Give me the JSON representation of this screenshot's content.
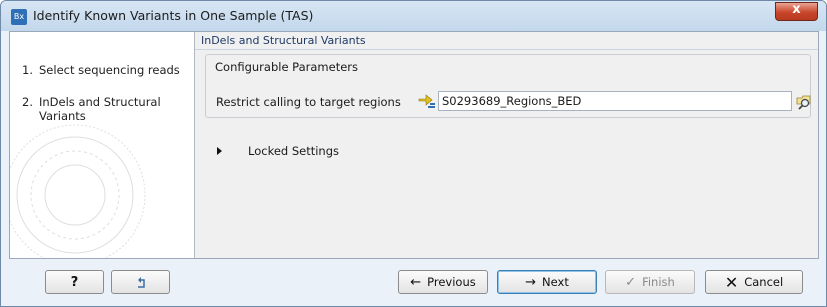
{
  "window": {
    "title": "Identify Known Variants in One Sample (TAS)",
    "app_icon_text": "Bx",
    "close_glyph": "x"
  },
  "steps": [
    {
      "number": "1.",
      "label": "Select sequencing reads"
    },
    {
      "number": "2.",
      "label": "InDels and Structural Variants"
    }
  ],
  "panel": {
    "header": "InDels and Structural Variants",
    "group_title": "Configurable Parameters",
    "restrict_label": "Restrict calling to target regions",
    "restrict_value": "S0293689_Regions_BED",
    "locked_label": "Locked Settings"
  },
  "buttons": {
    "help": "?",
    "previous": "Previous",
    "next": "Next",
    "finish": "Finish",
    "cancel": "Cancel"
  },
  "icons": {
    "help": "question-mark-icon",
    "reset": "reset-arrow-icon",
    "previous": "arrow-left-icon",
    "next": "arrow-right-icon",
    "finish": "checkmark-icon",
    "cancel": "x-icon",
    "region": "region-track-icon",
    "browse": "browse-magnifier-icon"
  },
  "colors": {
    "title_bar": "#c3d7ec",
    "close_button": "#c9462b",
    "panel_header": "#1f3a66"
  }
}
